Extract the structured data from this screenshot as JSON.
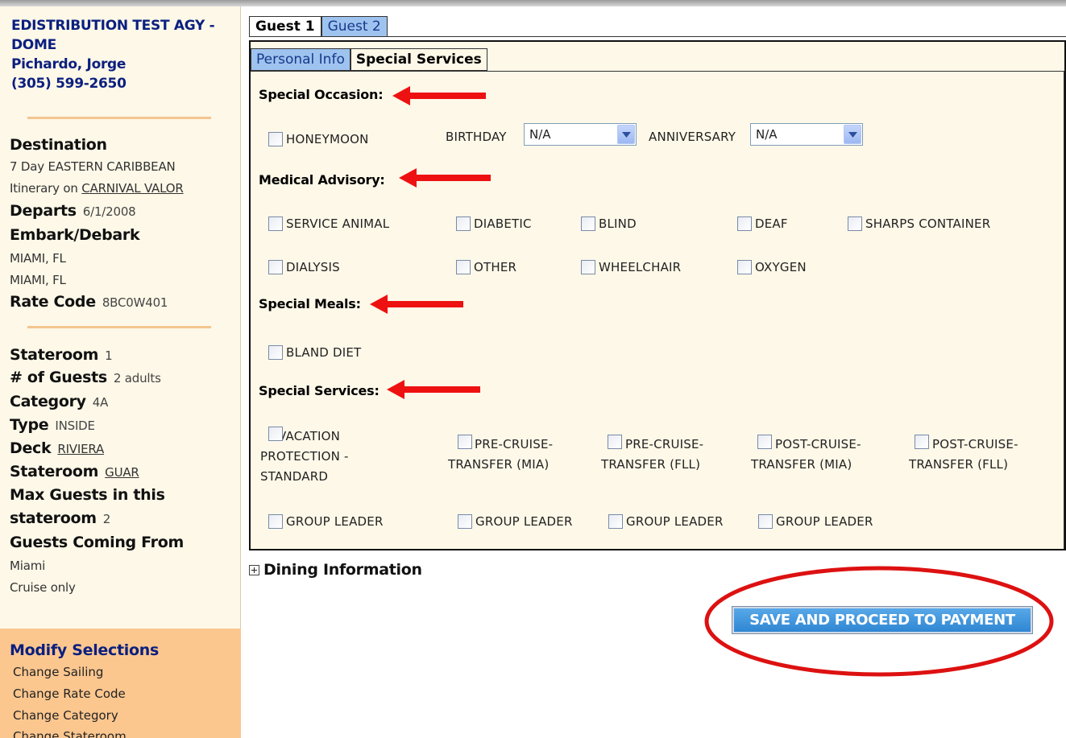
{
  "sidebar": {
    "agency": {
      "name": "EDISTRIBUTION TEST AGY - DOME",
      "agent": "Pichardo, Jorge",
      "phone": "(305) 599-2650"
    },
    "destination_label": "Destination",
    "destination_value": "7 Day EASTERN CARIBBEAN",
    "itinerary_prefix": "Itinerary on",
    "ship": "CARNIVAL VALOR",
    "departs_label": "Departs",
    "departs_value": "6/1/2008",
    "embark_label": "Embark/Debark",
    "embark_port": "MIAMI, FL",
    "debark_port": "MIAMI, FL",
    "rate_code_label": "Rate Code",
    "rate_code_value": "8BC0W401",
    "stateroom_label": "Stateroom",
    "stateroom_value": "1",
    "guests_label": "# of Guests",
    "guests_value": "2 adults",
    "category_label": "Category",
    "category_value": "4A",
    "type_label": "Type",
    "type_value": "INSIDE",
    "deck_label": "Deck",
    "deck_value": "RIVIERA",
    "stateroom2_label": "Stateroom",
    "stateroom2_value": "GUAR",
    "max_guests_label_1": "Max Guests in this",
    "max_guests_label_2": "stateroom",
    "max_guests_value": "2",
    "coming_from_label": "Guests Coming From",
    "coming_from_city": "Miami",
    "coming_from_note": "Cruise only",
    "modify": {
      "title": "Modify Selections",
      "items": [
        "Change Sailing",
        "Change Rate Code",
        "Change Category",
        "Change Stateroom"
      ]
    }
  },
  "guest_tabs": [
    "Guest 1",
    "Guest 2"
  ],
  "sub_tabs": [
    "Personal Info",
    "Special Services"
  ],
  "special_occasion": {
    "title": "Special Occasion:",
    "honeymoon": "HONEYMOON",
    "birthday_label": "BIRTHDAY",
    "birthday_value": "N/A",
    "anniversary_label": "ANNIVERSARY",
    "anniversary_value": "N/A"
  },
  "medical_advisory": {
    "title": "Medical Advisory:",
    "items": [
      "SERVICE ANIMAL",
      "DIABETIC",
      "BLIND",
      "DEAF",
      "SHARPS CONTAINER",
      "DIALYSIS",
      "OTHER",
      "WHEELCHAIR",
      "OXYGEN"
    ]
  },
  "special_meals": {
    "title": "Special Meals:",
    "items": [
      "BLAND DIET"
    ]
  },
  "special_services": {
    "title": "Special Services:",
    "vacation_protection": "VACATION PROTECTION - STANDARD",
    "pre_cruise_mia": "PRE-CRUISE-TRANSFER (MIA)",
    "pre_cruise_fll": "PRE-CRUISE-TRANSFER (FLL)",
    "post_cruise_mia": "POST-CRUISE-TRANSFER (MIA)",
    "post_cruise_fll": "POST-CRUISE-TRANSFER (FLL)",
    "group_leader": [
      "GROUP LEADER",
      "GROUP LEADER",
      "GROUP LEADER",
      "GROUP LEADER"
    ]
  },
  "dining": {
    "label": "Dining Information"
  },
  "save_button": "SAVE AND PROCEED TO PAYMENT",
  "colors": {
    "arrow": "#ee1111",
    "circle": "#dd1111",
    "button": "#3a8fd8",
    "sidebar_bg": "#fdf8e8",
    "modify_bg": "#fcc78f"
  }
}
